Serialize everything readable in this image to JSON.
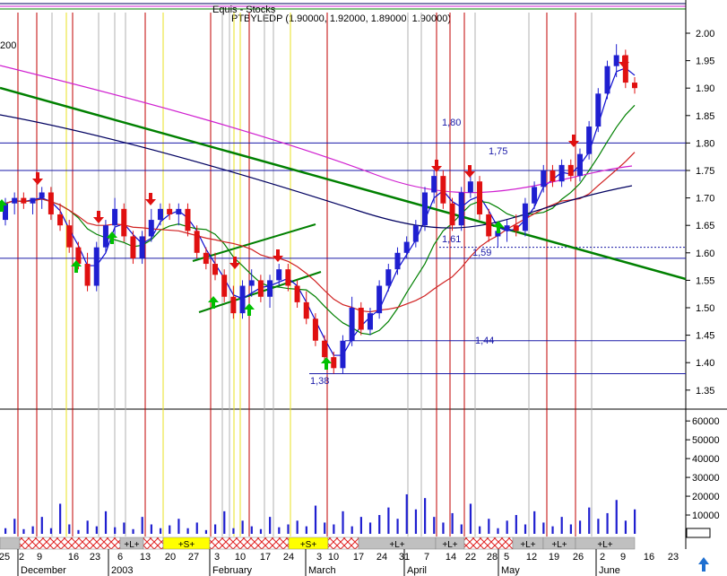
{
  "header": {
    "line1": "Equis - Stocks",
    "line2": "PTBYLEDP (1.90000, 1.92000, 1.89000, 1.90000)",
    "partial_left": "200"
  },
  "colors": {
    "up_candle": "#1f1fd0",
    "down_candle": "#e01010",
    "ma_short": "#0a0ad0",
    "ma_mid": "#008000",
    "ma_long": "#d02020",
    "ma_magenta": "#d020d0",
    "ma_navy": "#000060",
    "trendline": "#008000",
    "support_line": "#1a1aa8",
    "red_vline": "#c00000",
    "yellow_vline": "#e8e020",
    "grey_vline": "#b0b0b0",
    "arrow_buy": "#00c000",
    "arrow_sell": "#e01010",
    "volume": "#1f1fd0",
    "seg_grey": "#c0c0c0",
    "seg_yellow": "#ffff00",
    "seg_hatch": "#e02020"
  },
  "icons": {
    "buy_arrow": "green-up-arrow-icon",
    "sell_arrow": "red-down-arrow-icon",
    "scroll": "blue-up-arrow-icon"
  },
  "chart_data": {
    "type": "candlestick",
    "title": "PTBYLEDP",
    "y_price_ticks": [
      "2.00",
      "1.95",
      "1.90",
      "1.85",
      "1.80",
      "1.75",
      "1.70",
      "1.65",
      "1.60",
      "1.55",
      "1.50",
      "1.45",
      "1.40",
      "1.35"
    ],
    "price_ylim": [
      1.33,
      2.02
    ],
    "y_volume_ticks": [
      "60000",
      "50000",
      "40000",
      "30000",
      "20000",
      "10000"
    ],
    "volume_ylim": [
      0,
      62000
    ],
    "x_day_ticks": [
      "25",
      "2",
      "9",
      "16",
      "23",
      "6",
      "13",
      "20",
      "27",
      "3",
      "10",
      "17",
      "24",
      "3",
      "10",
      "17",
      "24",
      "31",
      "7",
      "14",
      "22",
      "28",
      "5",
      "12",
      "19",
      "26",
      "2",
      "9",
      "16",
      "23"
    ],
    "x_month_labels": [
      {
        "label": "December",
        "day_index": 5
      },
      {
        "label": "2003",
        "day_index": 25
      },
      {
        "label": "February",
        "day_index": 55
      },
      {
        "label": "March",
        "day_index": 75
      },
      {
        "label": "April",
        "day_index": 100
      },
      {
        "label": "May",
        "day_index": 120
      },
      {
        "label": "June",
        "day_index": 145
      }
    ],
    "price_annotations": [
      {
        "text": "1,80",
        "value": 1.8
      },
      {
        "text": "1,75",
        "value": 1.75
      },
      {
        "text": "1,61",
        "value": 1.61
      },
      {
        "text": "1,59",
        "value": 1.59
      },
      {
        "text": "1,44",
        "value": 1.44
      },
      {
        "text": "1,38",
        "value": 1.38
      }
    ],
    "support_levels": [
      1.8,
      1.75,
      1.61,
      1.59,
      1.44,
      1.38
    ],
    "segments": [
      {
        "label": "",
        "kind": "grey"
      },
      {
        "label": "",
        "kind": "hatch"
      },
      {
        "label": "+L+",
        "kind": "grey"
      },
      {
        "label": "",
        "kind": "hatch"
      },
      {
        "label": "+S+",
        "kind": "yellow"
      },
      {
        "label": "",
        "kind": "hatch"
      },
      {
        "label": "+S+",
        "kind": "yellow"
      },
      {
        "label": "",
        "kind": "hatch"
      },
      {
        "label": "+L+",
        "kind": "grey"
      },
      {
        "label": "+L+",
        "kind": "grey"
      },
      {
        "label": "",
        "kind": "hatch"
      },
      {
        "label": "+L+",
        "kind": "grey"
      },
      {
        "label": "+L+",
        "kind": "grey"
      },
      {
        "label": "+L+",
        "kind": "grey"
      }
    ],
    "candles": [
      [
        1.66,
        1.7,
        1.65,
        1.69
      ],
      [
        1.69,
        1.71,
        1.67,
        1.7
      ],
      [
        1.7,
        1.71,
        1.68,
        1.69
      ],
      [
        1.69,
        1.7,
        1.67,
        1.7
      ],
      [
        1.7,
        1.72,
        1.68,
        1.71
      ],
      [
        1.71,
        1.72,
        1.66,
        1.67
      ],
      [
        1.67,
        1.69,
        1.64,
        1.65
      ],
      [
        1.65,
        1.66,
        1.6,
        1.61
      ],
      [
        1.61,
        1.62,
        1.57,
        1.58
      ],
      [
        1.58,
        1.6,
        1.53,
        1.54
      ],
      [
        1.54,
        1.62,
        1.53,
        1.61
      ],
      [
        1.61,
        1.66,
        1.6,
        1.65
      ],
      [
        1.65,
        1.7,
        1.63,
        1.68
      ],
      [
        1.68,
        1.69,
        1.62,
        1.63
      ],
      [
        1.63,
        1.64,
        1.58,
        1.59
      ],
      [
        1.59,
        1.64,
        1.58,
        1.63
      ],
      [
        1.63,
        1.68,
        1.62,
        1.66
      ],
      [
        1.66,
        1.69,
        1.65,
        1.68
      ],
      [
        1.68,
        1.69,
        1.66,
        1.67
      ],
      [
        1.67,
        1.69,
        1.65,
        1.68
      ],
      [
        1.68,
        1.69,
        1.63,
        1.64
      ],
      [
        1.64,
        1.65,
        1.59,
        1.6
      ],
      [
        1.6,
        1.61,
        1.57,
        1.58
      ],
      [
        1.58,
        1.6,
        1.55,
        1.56
      ],
      [
        1.56,
        1.57,
        1.51,
        1.52
      ],
      [
        1.52,
        1.54,
        1.48,
        1.49
      ],
      [
        1.49,
        1.55,
        1.48,
        1.54
      ],
      [
        1.54,
        1.57,
        1.52,
        1.55
      ],
      [
        1.55,
        1.56,
        1.51,
        1.52
      ],
      [
        1.52,
        1.56,
        1.5,
        1.55
      ],
      [
        1.55,
        1.58,
        1.54,
        1.57
      ],
      [
        1.57,
        1.58,
        1.53,
        1.54
      ],
      [
        1.54,
        1.55,
        1.5,
        1.51
      ],
      [
        1.51,
        1.53,
        1.47,
        1.48
      ],
      [
        1.48,
        1.49,
        1.43,
        1.44
      ],
      [
        1.44,
        1.45,
        1.4,
        1.41
      ],
      [
        1.41,
        1.42,
        1.38,
        1.39
      ],
      [
        1.39,
        1.45,
        1.38,
        1.44
      ],
      [
        1.44,
        1.52,
        1.43,
        1.5
      ],
      [
        1.5,
        1.51,
        1.45,
        1.46
      ],
      [
        1.46,
        1.5,
        1.45,
        1.49
      ],
      [
        1.49,
        1.55,
        1.48,
        1.54
      ],
      [
        1.54,
        1.58,
        1.53,
        1.57
      ],
      [
        1.57,
        1.61,
        1.56,
        1.6
      ],
      [
        1.6,
        1.63,
        1.59,
        1.62
      ],
      [
        1.62,
        1.66,
        1.61,
        1.65
      ],
      [
        1.65,
        1.72,
        1.64,
        1.71
      ],
      [
        1.71,
        1.75,
        1.69,
        1.74
      ],
      [
        1.74,
        1.75,
        1.68,
        1.69
      ],
      [
        1.69,
        1.7,
        1.64,
        1.65
      ],
      [
        1.65,
        1.72,
        1.64,
        1.71
      ],
      [
        1.71,
        1.75,
        1.7,
        1.73
      ],
      [
        1.73,
        1.74,
        1.66,
        1.67
      ],
      [
        1.67,
        1.68,
        1.62,
        1.63
      ],
      [
        1.63,
        1.65,
        1.61,
        1.64
      ],
      [
        1.64,
        1.66,
        1.62,
        1.65
      ],
      [
        1.65,
        1.67,
        1.63,
        1.64
      ],
      [
        1.64,
        1.7,
        1.63,
        1.69
      ],
      [
        1.69,
        1.73,
        1.68,
        1.72
      ],
      [
        1.72,
        1.76,
        1.71,
        1.75
      ],
      [
        1.75,
        1.76,
        1.72,
        1.73
      ],
      [
        1.73,
        1.77,
        1.72,
        1.76
      ],
      [
        1.76,
        1.77,
        1.73,
        1.74
      ],
      [
        1.74,
        1.79,
        1.73,
        1.78
      ],
      [
        1.78,
        1.84,
        1.77,
        1.83
      ],
      [
        1.83,
        1.9,
        1.82,
        1.89
      ],
      [
        1.89,
        1.95,
        1.88,
        1.94
      ],
      [
        1.94,
        1.98,
        1.92,
        1.96
      ],
      [
        1.96,
        1.97,
        1.9,
        1.91
      ],
      [
        1.91,
        1.92,
        1.89,
        1.9
      ]
    ],
    "volume": [
      3000,
      8000,
      2500,
      4000,
      9000,
      3000,
      16000,
      5000,
      2000,
      7000,
      4000,
      12000,
      3500,
      6000,
      2500,
      9000,
      5000,
      3000,
      4500,
      8000,
      3000,
      6000,
      2000,
      5000,
      12000,
      3000,
      7000,
      4000,
      2500,
      9000,
      3500,
      5000,
      7000,
      4000,
      15000,
      6000,
      5000,
      12000,
      4000,
      9000,
      6000,
      10000,
      14000,
      8000,
      21000,
      13000,
      19000,
      9000,
      6000,
      11000,
      5000,
      16000,
      4000,
      8000,
      3000,
      7000,
      10000,
      5000,
      12000,
      6000,
      4000,
      9000,
      5000,
      7000,
      14000,
      8000,
      11000,
      18000,
      7000,
      13000
    ]
  }
}
